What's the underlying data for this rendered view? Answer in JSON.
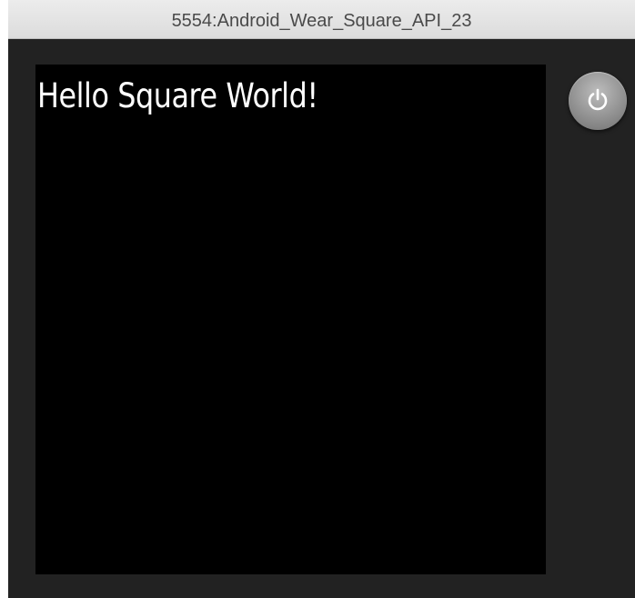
{
  "window": {
    "title": "5554:Android_Wear_Square_API_23"
  },
  "device_screen": {
    "text": "Hello Square World!"
  },
  "controls": {
    "power_icon": "power-icon"
  }
}
